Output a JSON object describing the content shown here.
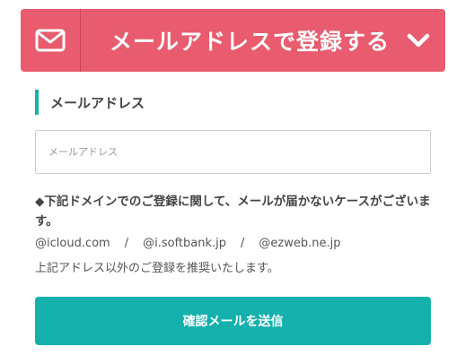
{
  "header": {
    "title": "メールアドレスで登録する",
    "left_icon": "mail-icon",
    "right_icon": "chevron-down-icon",
    "color": "#e95b6e"
  },
  "form": {
    "section_label": "メールアドレス",
    "email_placeholder": "メールアドレス",
    "email_value": "",
    "accent_color": "#17b0aa"
  },
  "notice": {
    "heading": "◆下記ドメインでのご登録に関して、メールが届かないケースがございます。",
    "domains": [
      "@icloud.com",
      "@i.softbank.jp",
      "@ezweb.ne.jp"
    ],
    "separator": "/",
    "footer": "上記アドレス以外のご登録を推奨いたします。"
  },
  "submit": {
    "label": "確認メールを送信",
    "color": "#14b1ac"
  }
}
